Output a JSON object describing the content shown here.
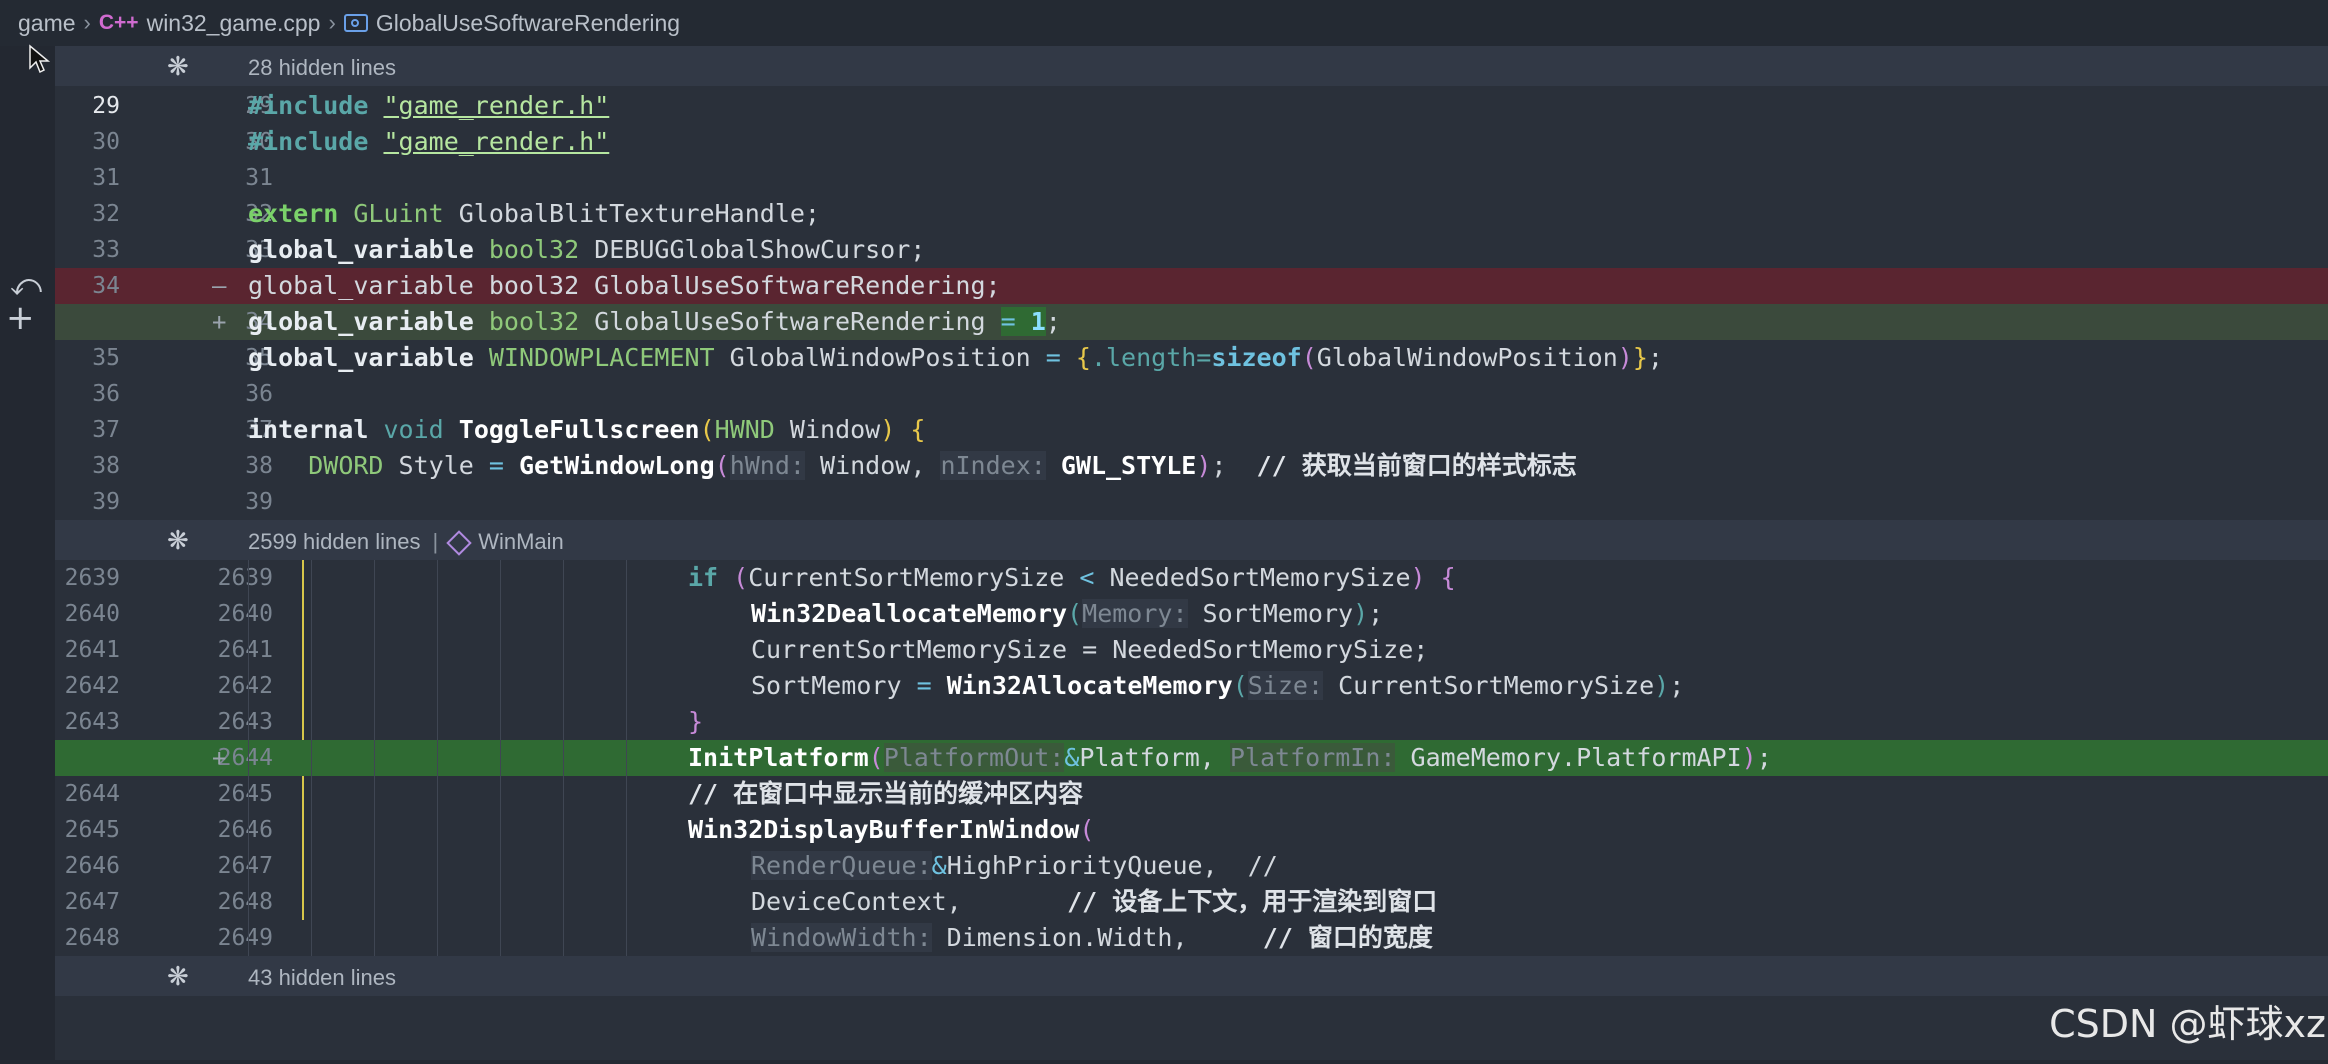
{
  "breadcrumb": {
    "root": "game",
    "file_icon": "C++",
    "file": "win32_game.cpp",
    "symbol": "GlobalUseSoftwareRendering"
  },
  "hidden": [
    {
      "label": "28 hidden lines"
    },
    {
      "label": "2599 hidden lines",
      "scope": "WinMain"
    },
    {
      "label": "43 hidden lines"
    }
  ],
  "lines": [
    {
      "old": "29",
      "new": "29",
      "mark": ""
    },
    {
      "old": "30",
      "new": "30",
      "mark": ""
    },
    {
      "old": "31",
      "new": "31",
      "mark": ""
    },
    {
      "old": "32",
      "new": "32",
      "mark": ""
    },
    {
      "old": "33",
      "new": "33",
      "mark": ""
    },
    {
      "old": "34",
      "new": "",
      "mark": "—"
    },
    {
      "old": "",
      "new": "34",
      "mark": "+"
    },
    {
      "old": "35",
      "new": "35",
      "mark": ""
    },
    {
      "old": "36",
      "new": "36",
      "mark": ""
    },
    {
      "old": "37",
      "new": "37",
      "mark": ""
    },
    {
      "old": "38",
      "new": "38",
      "mark": ""
    },
    {
      "old": "39",
      "new": "39",
      "mark": ""
    },
    {
      "old": "2639",
      "new": "2639",
      "mark": ""
    },
    {
      "old": "2640",
      "new": "2640",
      "mark": ""
    },
    {
      "old": "2641",
      "new": "2641",
      "mark": ""
    },
    {
      "old": "2642",
      "new": "2642",
      "mark": ""
    },
    {
      "old": "2643",
      "new": "2643",
      "mark": ""
    },
    {
      "old": "",
      "new": "2644",
      "mark": "+"
    },
    {
      "old": "2644",
      "new": "2645",
      "mark": ""
    },
    {
      "old": "2645",
      "new": "2646",
      "mark": ""
    },
    {
      "old": "2646",
      "new": "2647",
      "mark": ""
    },
    {
      "old": "2647",
      "new": "2648",
      "mark": ""
    },
    {
      "old": "2648",
      "new": "2649",
      "mark": ""
    }
  ],
  "code": {
    "include": "#include",
    "game_render": "\"game_render.h\"",
    "extern": "extern",
    "GLuint": "GLuint",
    "blit": " GlobalBlitTextureHandle;",
    "global_variable": "global_variable",
    "bool32": "bool32",
    "showcursor": " DEBUGGlobalShowCursor;",
    "usesw_del": "global_variable bool32 GlobalUseSoftwareRendering;",
    "usesw_name": " GlobalUseSoftwareRendering ",
    "eq": "=",
    "one": "1",
    "semi": ";",
    "windowplacement": "WINDOWPLACEMENT",
    "winpos": " GlobalWindowPosition ",
    "brace_open": "{",
    "length": ".length=",
    "sizeof": "sizeof",
    "paren_open": "(",
    "winpos_arg": "GlobalWindowPosition",
    "paren_close": ")",
    "brace_close": "}",
    "internal": "internal",
    "void": "void",
    "togglefs": "ToggleFullscreen",
    "hwnd": "HWND",
    "window_param": " Window",
    "dword": "DWORD",
    "style": " Style ",
    "getwindowlong": "GetWindowLong",
    "hint_hwnd": "hWnd:",
    "window_arg": " Window, ",
    "hint_nindex": "nIndex:",
    "gwl_style": " GWL_STYLE",
    "comment_style": "// 获取当前窗口的样式标志",
    "if": "if",
    "cond_a": "CurrentSortMemorySize ",
    "lt": "<",
    "cond_b": " NeededSortMemorySize",
    "dealloc": "Win32DeallocateMemory",
    "hint_memory": "Memory:",
    "sortmem": " SortMemory",
    "assign_size": "CurrentSortMemorySize = NeededSortMemorySize;",
    "sortmem_var": "SortMemory ",
    "alloc": "Win32AllocateMemory",
    "hint_size": "Size:",
    "size_arg": " CurrentSortMemorySize",
    "close_brace": "}",
    "initplatform": "InitPlatform",
    "hint_pout": "PlatformOut:",
    "amp": "&",
    "platform_arg": "Platform, ",
    "hint_pin": "PlatformIn:",
    "platform_api": " GameMemory.PlatformAPI",
    "comment_display": "// 在窗口中显示当前的缓冲区内容",
    "displaybuf": "Win32DisplayBufferInWindow",
    "hint_rq": "RenderQueue:",
    "hpq": "HighPriorityQueue,  //",
    "devctx": "DeviceContext,",
    "comment_dc": "// 设备上下文，用于渲染到窗口",
    "hint_ww": "WindowWidth:",
    "dim_width": " Dimension.Width,",
    "comment_ww": "// 窗口的宽度"
  },
  "watermark": "CSDN @虾球xz"
}
